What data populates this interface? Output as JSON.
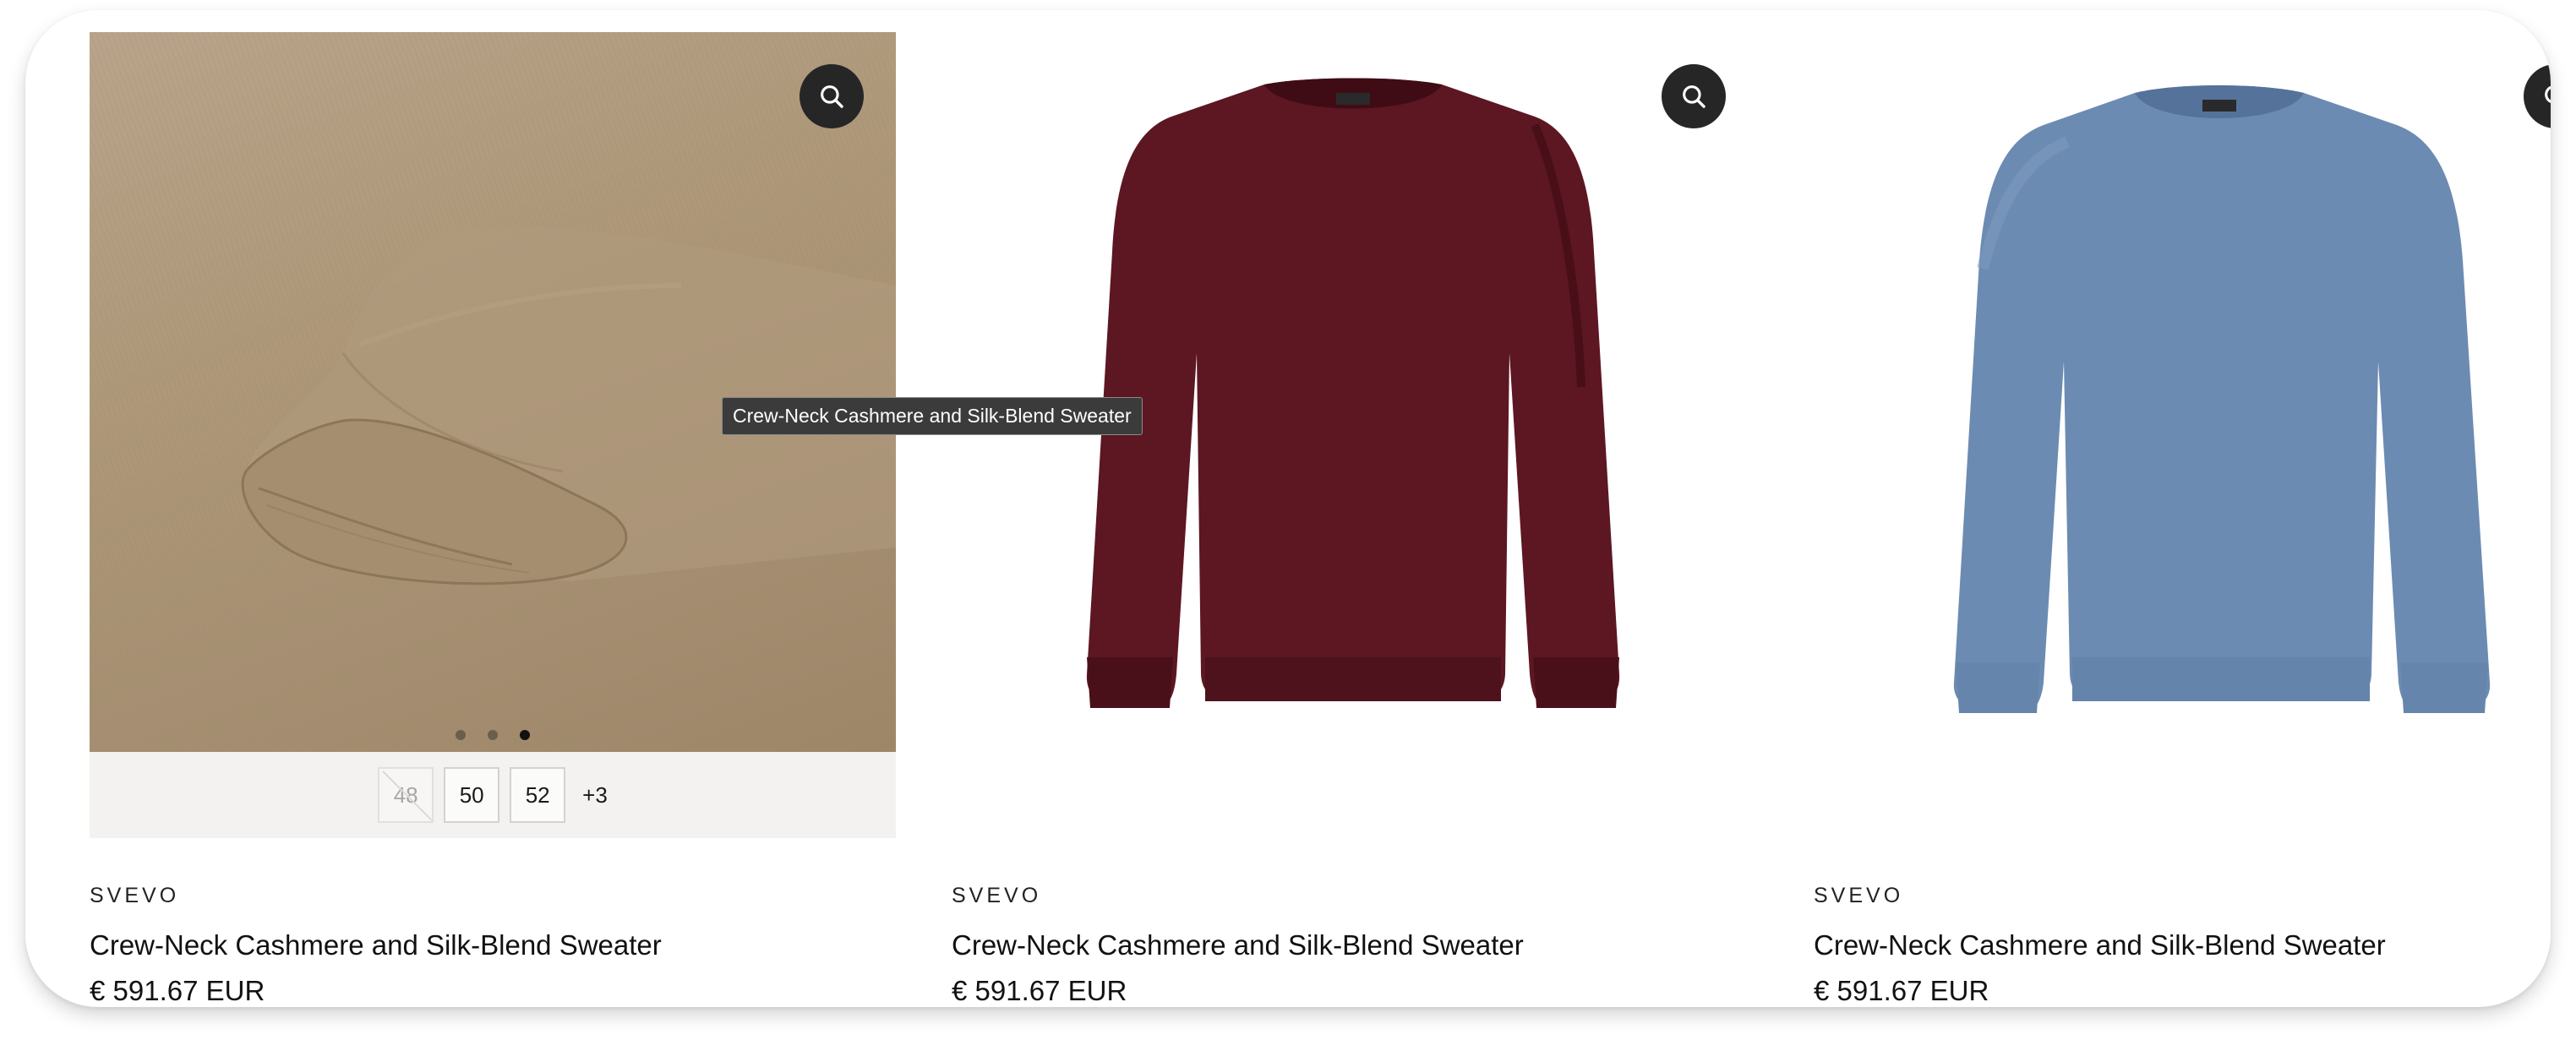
{
  "products": [
    {
      "brand": "SVEVO",
      "name": "Crew-Neck Cashmere and Silk-Blend Sweater",
      "price": "€ 591.67 EUR",
      "image_color": "#a99375",
      "sizes": [
        "48",
        "50",
        "52"
      ],
      "sizes_more": "+3",
      "carousel_total": 3,
      "carousel_active": 3
    },
    {
      "brand": "SVEVO",
      "name": "Crew-Neck Cashmere and Silk-Blend Sweater",
      "price": "€ 591.67 EUR",
      "image_color": "#5e1a24"
    },
    {
      "brand": "SVEVO",
      "name": "Crew-Neck Cashmere and Silk-Blend Sweater",
      "price": "€ 591.67 EUR",
      "image_color": "#6f8db3"
    }
  ],
  "tooltip": "Crew-Neck Cashmere and Silk-Blend Sweater",
  "icons": {
    "zoom": "search-icon"
  }
}
